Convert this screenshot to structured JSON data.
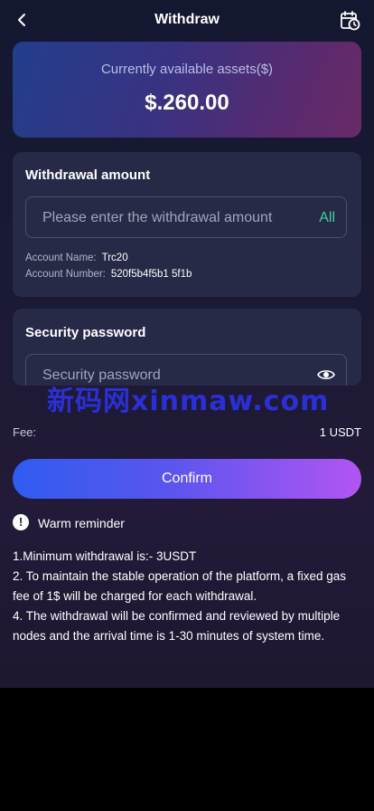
{
  "header": {
    "title": "Withdraw",
    "back_icon": "chevron-left-icon",
    "history_icon": "calendar-clock-icon"
  },
  "assets": {
    "label": "Currently available assets($)",
    "value": "$.260.00"
  },
  "withdrawal": {
    "title": "Withdrawal amount",
    "placeholder": "Please enter the withdrawal amount",
    "all_label": "All",
    "account_name_label": "Account Name:",
    "account_name_value": "Trc20",
    "account_number_label": "Account Number:",
    "account_number_value": "520f5b4f5b1 5f1b"
  },
  "security": {
    "title": "Security password",
    "placeholder": "Security password",
    "eye_icon": "eye-icon"
  },
  "fee": {
    "label": "Fee:",
    "value": "1 USDT"
  },
  "confirm_label": "Confirm",
  "reminder": {
    "label": "Warm reminder",
    "icon": "exclamation-circle-icon"
  },
  "notes": [
    "1.Minimum withdrawal is:- 3USDT",
    "2. To maintain the stable operation of the platform, a fixed gas fee of 1$ will be charged for each withdrawal.",
    "4. The withdrawal will be confirmed and reviewed by multiple nodes and the arrival time is 1-30 minutes of system time."
  ],
  "watermark": "新码网xinmaw.com",
  "colors": {
    "accent_green": "#3fd29a",
    "button_start": "#2f5cf0",
    "button_end": "#b255f2"
  }
}
